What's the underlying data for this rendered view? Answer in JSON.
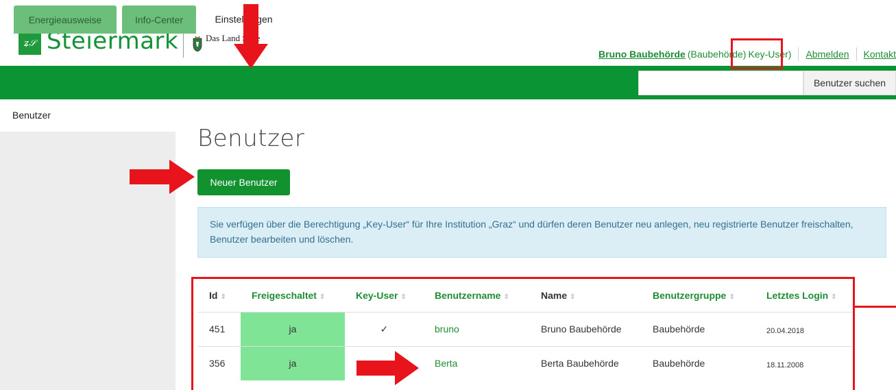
{
  "header": {
    "logo_icon": "steiermark-logo",
    "brand": "Steiermark",
    "crest_text": "Das Land Steiermark"
  },
  "userbar": {
    "user_name": "Bruno Baubehörde",
    "user_role": "(Baubehörde)",
    "key_user": "Key-User)",
    "logout": "Abmelden",
    "contact": "Kontakt"
  },
  "nav": {
    "tabs": [
      {
        "label": "Energieausweise"
      },
      {
        "label": "Info-Center"
      },
      {
        "label": "Einstellungen"
      }
    ],
    "search_placeholder": "",
    "search_button": "Benutzer suchen"
  },
  "sidebar": {
    "items": [
      {
        "label": "Benutzer"
      }
    ]
  },
  "main": {
    "title": "Benutzer",
    "new_button": "Neuer Benutzer",
    "info_text": "Sie verfügen über die Berechtigung „Key-User“ für Ihre Institution „Graz“ und dürfen deren Benutzer neu anlegen, neu registrierte Benutzer freischalten, Benutzer bearbeiten und löschen."
  },
  "table": {
    "columns": [
      "Id",
      "Freigeschaltet",
      "Key-User",
      "Benutzername",
      "Name",
      "Benutzergruppe",
      "Letztes Login"
    ],
    "sort_icon": "⇕",
    "rows": [
      {
        "id": "451",
        "freigeschaltet": "ja",
        "key_user": "✓",
        "benutzername": "bruno",
        "name": "Bruno Baubehörde",
        "gruppe": "Baubehörde",
        "login": "20.04.2018"
      },
      {
        "id": "356",
        "freigeschaltet": "ja",
        "key_user": "",
        "benutzername": "Berta",
        "name": "Berta Baubehörde",
        "gruppe": "Baubehörde",
        "login": "18.11.2008"
      }
    ]
  },
  "colors": {
    "brand_green": "#0b9434",
    "tab_inactive": "#6cbf7b",
    "annotation_red": "#e8141b",
    "freigeschaltet_bg": "#7fe496"
  }
}
